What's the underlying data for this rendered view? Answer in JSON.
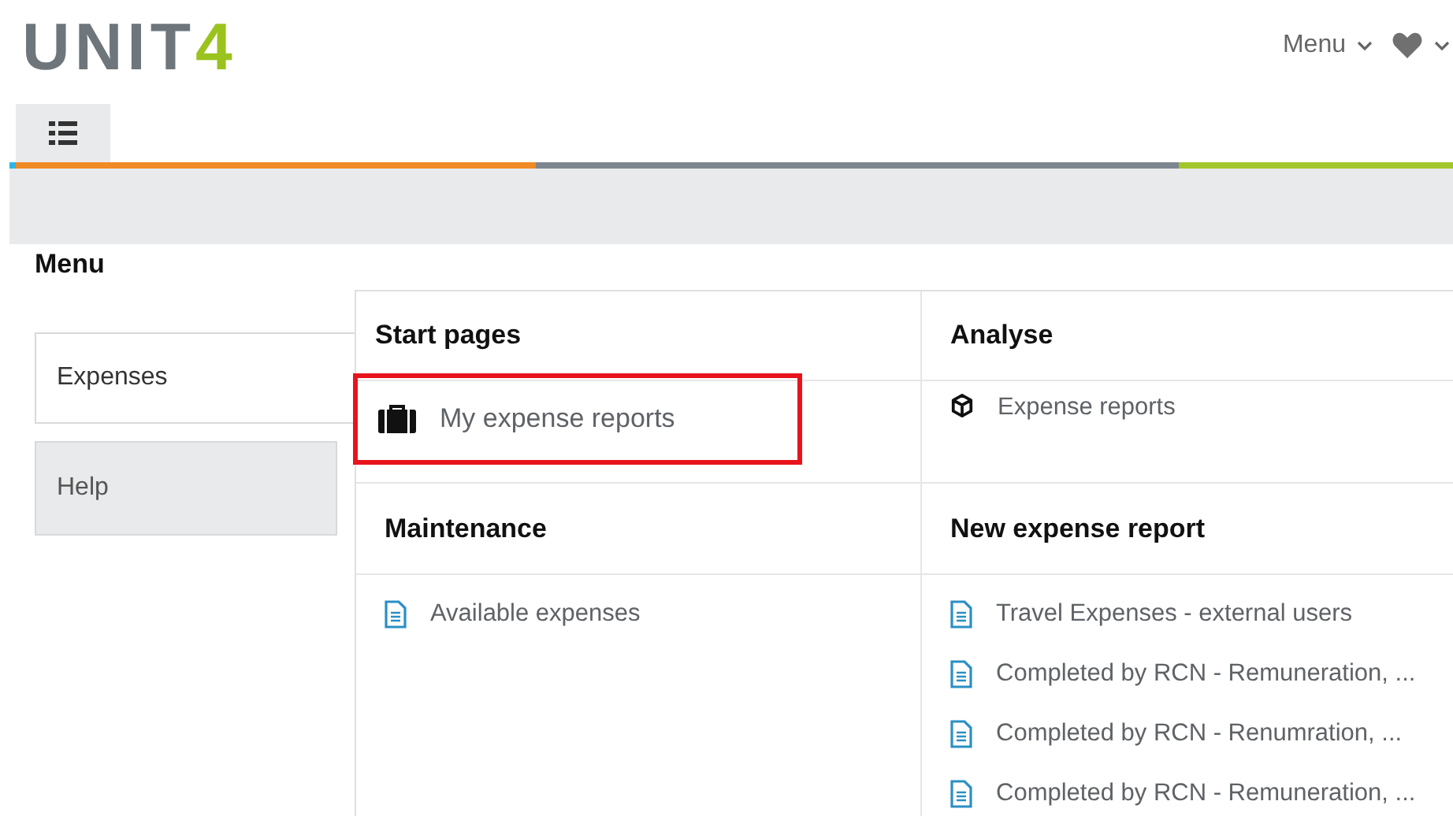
{
  "logo": {
    "text": "UNIT",
    "accent": "4"
  },
  "header_menu": {
    "label": "Menu"
  },
  "favorites": {
    "kind": "heart"
  },
  "tabs": [
    {
      "kind": "list",
      "selected": true
    }
  ],
  "menu_title": "Menu",
  "sidebar": {
    "items": [
      {
        "label": "Expenses",
        "selected": true
      },
      {
        "label": "Help",
        "selected": false
      }
    ]
  },
  "sections": [
    {
      "title": "Start pages",
      "items": [
        {
          "label": "My expense reports",
          "kind": "briefcase",
          "highlighted": true
        }
      ]
    },
    {
      "title": "Analyse",
      "items": [
        {
          "label": "Expense reports",
          "kind": "cube",
          "highlighted": false
        }
      ]
    },
    {
      "title": "Maintenance",
      "items": [
        {
          "label": "Available expenses",
          "kind": "document",
          "highlighted": false
        }
      ]
    },
    {
      "title": "New expense report",
      "items": [
        {
          "label": "Travel Expenses - external users",
          "kind": "document",
          "highlighted": false
        },
        {
          "label": "Completed by RCN - Remuneration, ...",
          "kind": "document",
          "highlighted": false
        },
        {
          "label": "Completed by RCN - Renumration, ...",
          "kind": "document",
          "highlighted": false
        },
        {
          "label": "Completed by RCN - Remuneration, ...",
          "kind": "document",
          "highlighted": false
        }
      ]
    }
  ]
}
